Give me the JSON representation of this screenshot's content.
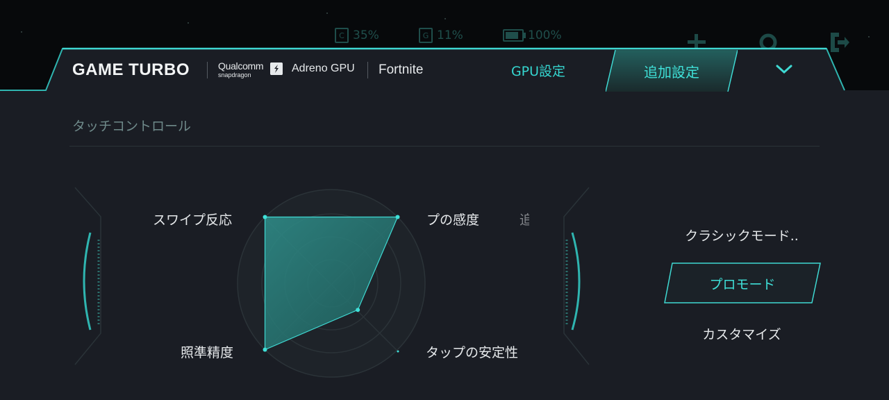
{
  "status": {
    "cpu_icon_label": "C",
    "cpu_value": "35%",
    "gpu_icon_label": "G",
    "gpu_value": "11%",
    "battery_value": "100%"
  },
  "header": {
    "brand": "GAME TURBO",
    "qualcomm_line1": "Qualcomm",
    "qualcomm_line2": "snapdragon",
    "gpu_name": "Adreno GPU",
    "game_name": "Fortnite",
    "tabs": [
      {
        "label": "GPU設定",
        "active": false
      },
      {
        "label": "追加設定",
        "active": true
      }
    ]
  },
  "touch": {
    "section_title": "タッチコントロール",
    "axes": {
      "swipe": "スワイプ反応",
      "tap_sensitivity": "プの感度",
      "tap_stability": "タップの安定性",
      "aim": "照準精度",
      "partial_next": "追"
    },
    "radar_values": {
      "swipe": 1.0,
      "tap_sensitivity": 1.0,
      "tap_stability": 0.4,
      "aim": 1.0
    },
    "modes": [
      {
        "label": "クラシックモード..",
        "selected": false
      },
      {
        "label": "プロモード",
        "selected": true
      },
      {
        "label": "カスタマイズ",
        "selected": false
      }
    ]
  },
  "colors": {
    "accent": "#35d6d0",
    "panel_bg": "#1a1d24",
    "top_bg": "#07090b"
  }
}
